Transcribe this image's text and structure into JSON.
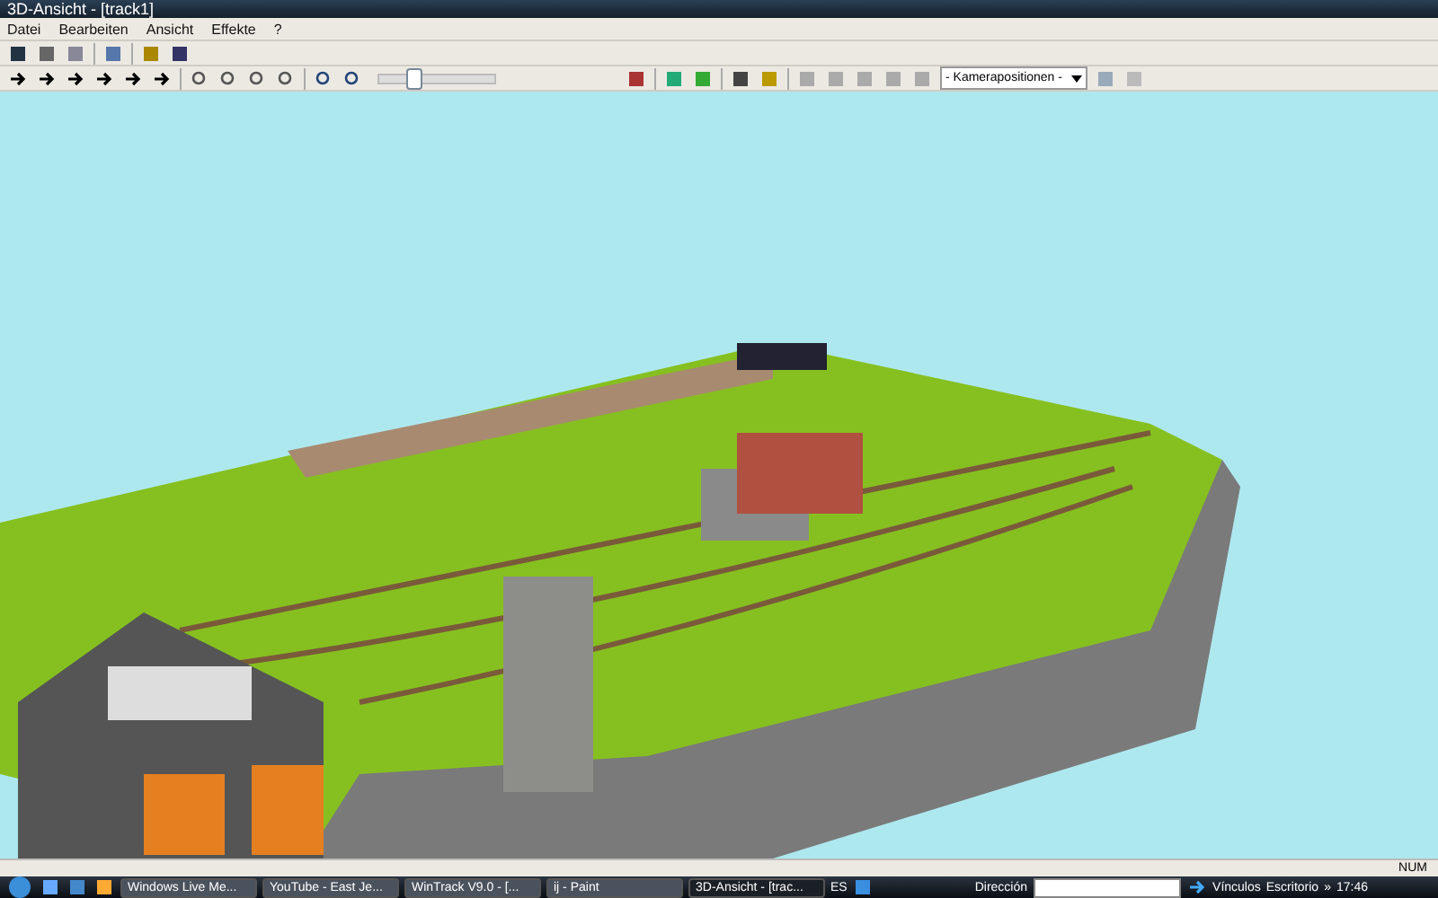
{
  "window": {
    "title": "3D-Ansicht - [track1]"
  },
  "menu": [
    "Datei",
    "Bearbeiten",
    "Ansicht",
    "Effekte",
    "?"
  ],
  "toolbar": {
    "zoom_slider": {
      "level": 0.3
    },
    "camera_dropdown": {
      "value": "- Kamerapositionen -"
    }
  },
  "status_bar": {
    "indicator": "NUM"
  },
  "taskbar": {
    "tasks": [
      {
        "label": "Windows Live Me...",
        "selected": false
      },
      {
        "label": "YouTube - East Je...",
        "selected": false
      },
      {
        "label": "WinTrack V9.0 - [...",
        "selected": false
      },
      {
        "label": "ij - Paint",
        "selected": false
      },
      {
        "label": "3D-Ansicht - [trac...",
        "selected": true
      }
    ],
    "language": "ES",
    "address_label": "Dirección",
    "links": "Vínculos",
    "desktop": "Escritorio",
    "more": "»",
    "clock": "17:46"
  }
}
